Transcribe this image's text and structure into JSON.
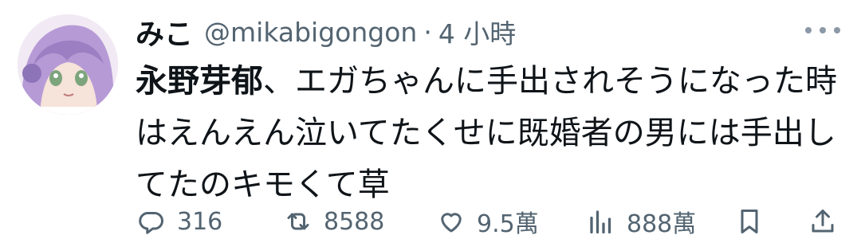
{
  "tweet": {
    "display_name": "みこ",
    "handle": "@mikabigongon",
    "separator": "·",
    "time": "4 小時",
    "text_mention": "永野芽郁",
    "text_body": "、エガちゃんに手出されそうになった時はえんえん泣いてたくせに既婚者の男には手出してたのキモくて草"
  },
  "actions": {
    "reply_count": "316",
    "retweet_count": "8588",
    "like_count": "9.5萬",
    "views_count": "888萬"
  },
  "colors": {
    "text": "#0f1419",
    "secondary": "#536471",
    "avatar_hair": "#b69ad6"
  },
  "icons": [
    "avatar",
    "more-icon",
    "reply-icon",
    "retweet-icon",
    "like-icon",
    "views-icon",
    "bookmark-icon",
    "share-icon"
  ]
}
